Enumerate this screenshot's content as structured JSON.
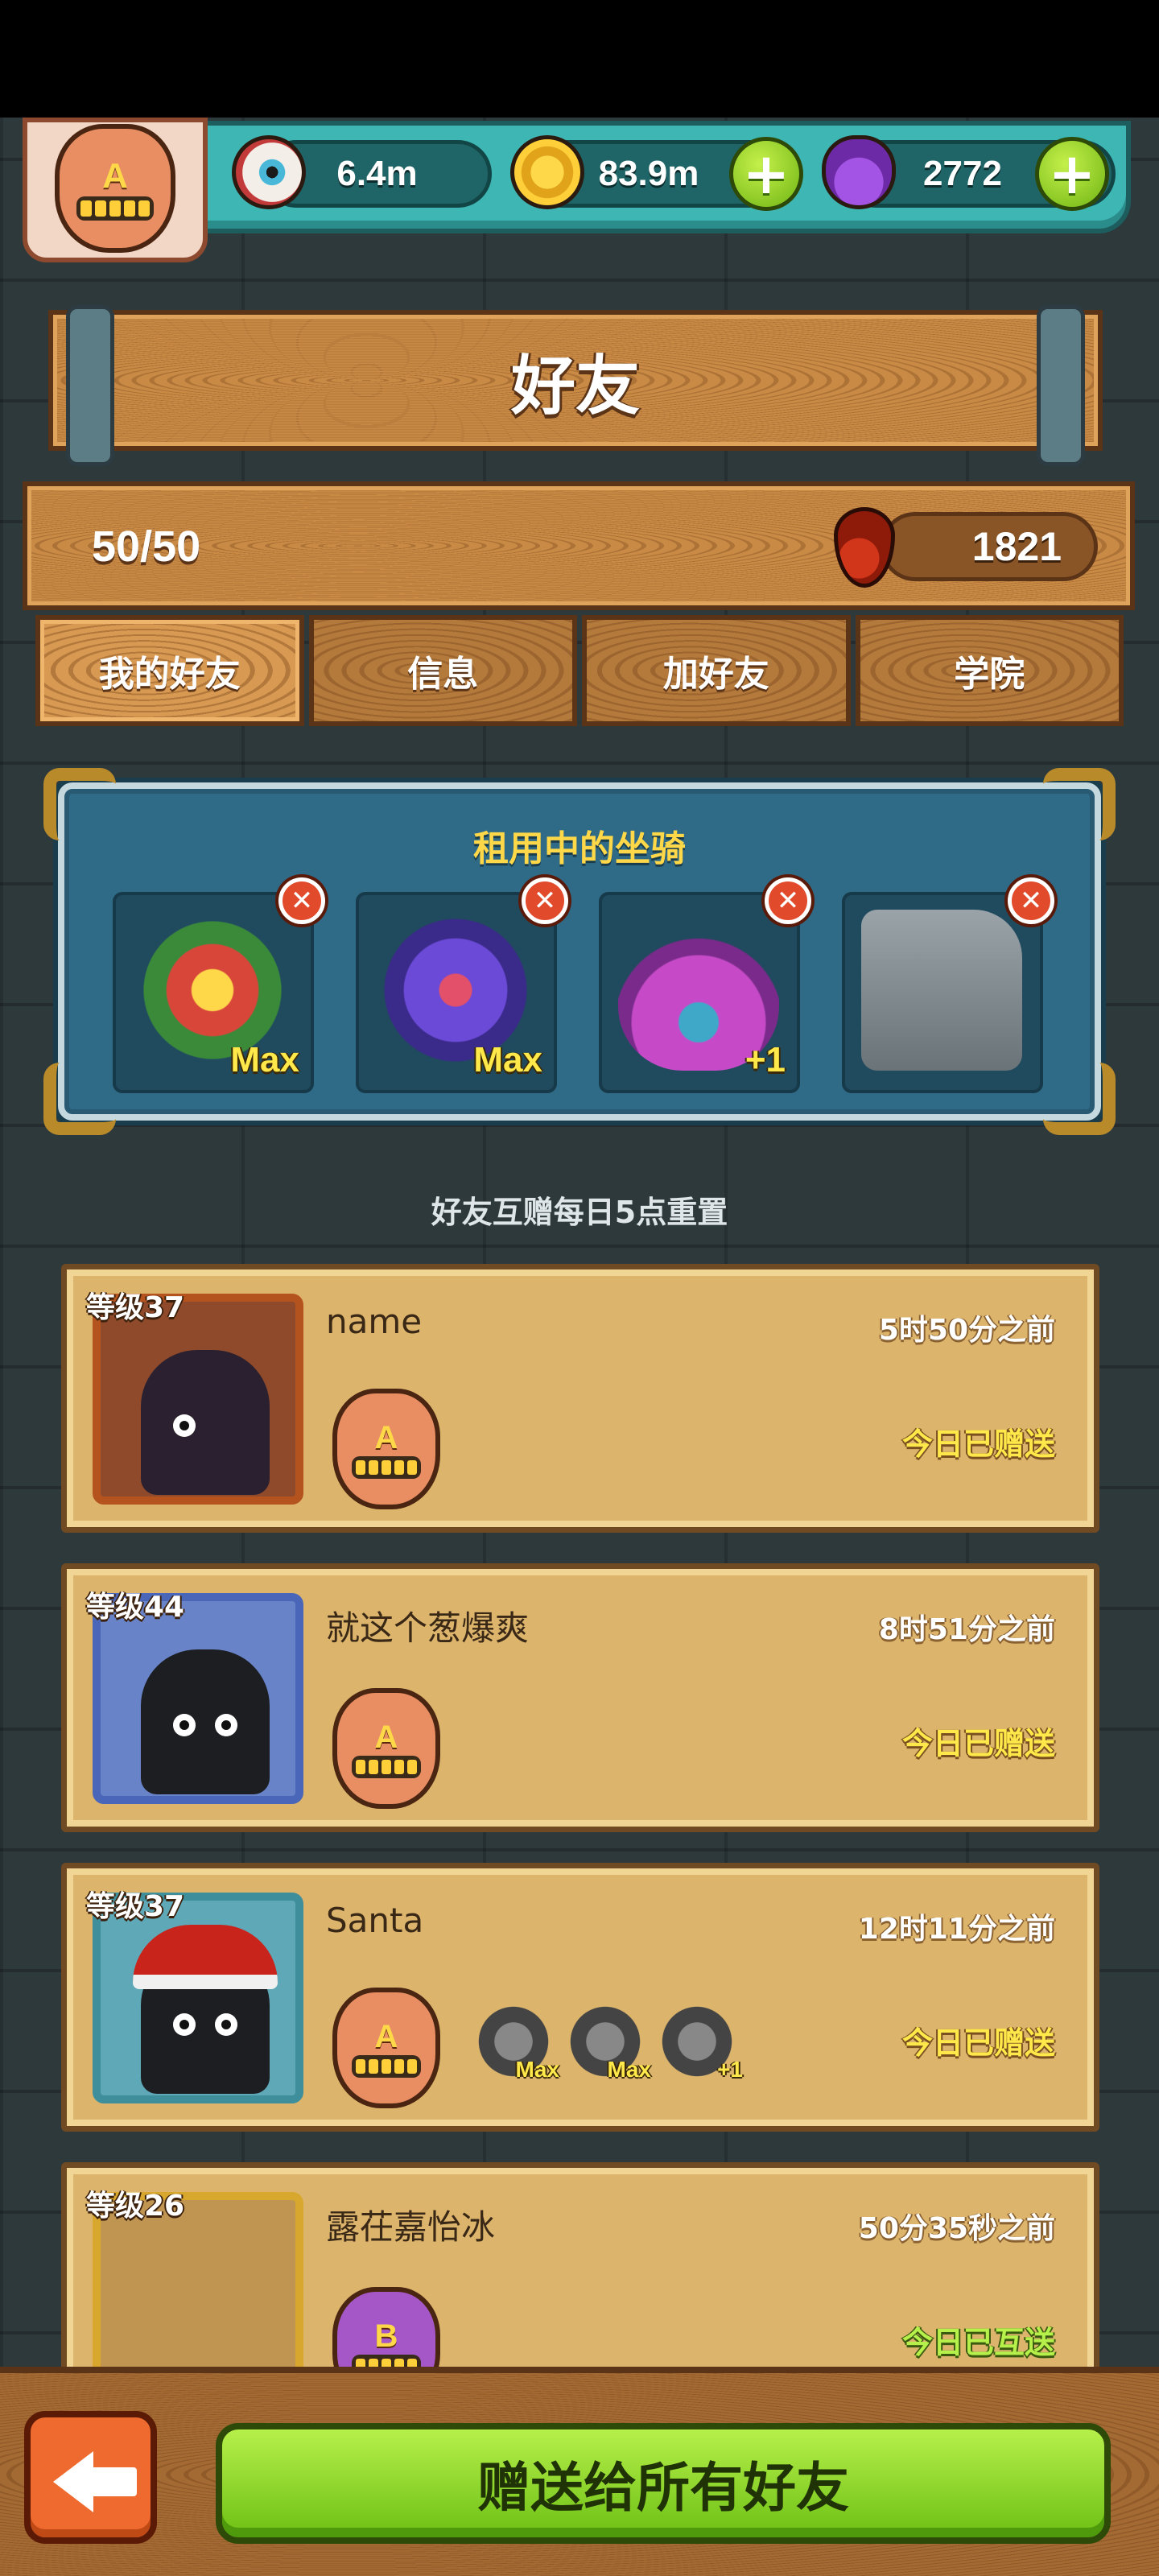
{
  "resources": {
    "eyes": "6.4m",
    "coins": "83.9m",
    "potions": "2772",
    "plus_symbol": "+"
  },
  "player_badge_letter": "A",
  "page_title": "好友",
  "friend_count": "50/50",
  "blood_count": "1821",
  "tabs": [
    {
      "label": "我的好友",
      "active": true
    },
    {
      "label": "信息",
      "active": false
    },
    {
      "label": "加好友",
      "active": false
    },
    {
      "label": "学院",
      "active": false
    }
  ],
  "mounts": {
    "title": "租用中的坐骑",
    "remove_symbol": "✕",
    "items": [
      {
        "level": "Max",
        "color": "#d8463a"
      },
      {
        "level": "Max",
        "color": "#6b4ad8"
      },
      {
        "level": "+1",
        "color": "#c64ac8"
      },
      {
        "level": "",
        "color": "#9aa4a8"
      }
    ]
  },
  "reset_note": "好友互赠每日5点重置",
  "friends": [
    {
      "level_label": "等级37",
      "name": "name",
      "badge": "A",
      "time": "5时50分之前",
      "status": "今日已赠送"
    },
    {
      "level_label": "等级44",
      "name": "就这个葱爆爽",
      "badge": "A",
      "time": "8时51分之前",
      "status": "今日已赠送"
    },
    {
      "level_label": "等级37",
      "name": "Santa",
      "badge": "A",
      "time": "12时11分之前",
      "status": "今日已赠送",
      "mounts": [
        {
          "level": "Max"
        },
        {
          "level": "Max"
        },
        {
          "level": "+1"
        }
      ]
    },
    {
      "level_label": "等级26",
      "name": "露茌嘉怡冰",
      "badge": "B",
      "time": "50分35秒之前",
      "status": "今日已互送"
    }
  ],
  "bottom": {
    "gift_all_label": "赠送给所有好友"
  }
}
